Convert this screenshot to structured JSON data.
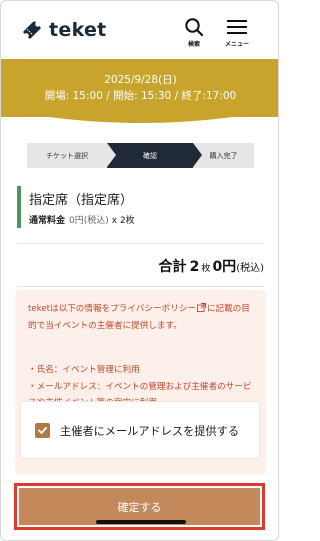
{
  "header": {
    "logo_text": "teket",
    "search_label": "検索",
    "menu_label": "メニュー"
  },
  "event": {
    "date": "2025/9/28(日)",
    "times": "開場: 15:00 / 開始: 15:30 / 終了:17:00"
  },
  "steps": [
    {
      "label": "チケット選択",
      "active": false
    },
    {
      "label": "確認",
      "active": true
    },
    {
      "label": "購入完了",
      "active": false
    }
  ],
  "seat": {
    "name": "指定席（指定席）",
    "kind": "通常料金",
    "price": "0円(税込)",
    "quantity": "x 2枚"
  },
  "total": {
    "label": "合計",
    "count": "2",
    "count_unit": "枚",
    "amount": "0円",
    "tax": "(税込)"
  },
  "notice": {
    "text_before_link": "teketは以下の情報を",
    "link": "プライバシーポリシー",
    "text_after_link": "に記載の目的で当イベントの主催者に提供します。",
    "items": [
      "・氏名：イベント管理に利用",
      "・メールアドレス：イベントの管理および主催者のサービスや主催イベント等の案内に利用"
    ]
  },
  "consent": {
    "label": "主催者にメールアドレスを提供する",
    "checked": true
  },
  "confirm_button": "確定する",
  "colors": {
    "banner": "#c9a42c",
    "active_step": "#1f2a36",
    "seat_accent": "#4a9660",
    "notice_text": "#c8452c",
    "notice_bg": "#fdf0ea",
    "confirm": "#c4895a",
    "highlight": "#e03a2e"
  }
}
